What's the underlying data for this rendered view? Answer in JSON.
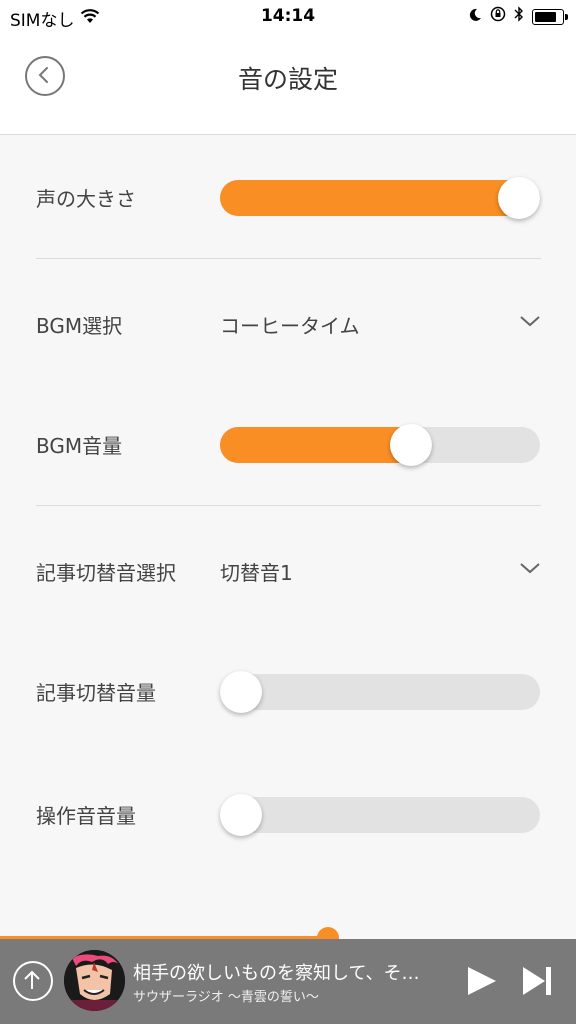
{
  "status_bar": {
    "carrier": "SIMなし",
    "time": "14:14"
  },
  "header": {
    "title": "音の設定"
  },
  "settings": {
    "voice_volume": {
      "label": "声の大きさ",
      "value": 1.0
    },
    "bgm_select": {
      "label": "BGM選択",
      "value": "コーヒータイム"
    },
    "bgm_volume": {
      "label": "BGM音量",
      "value": 0.61
    },
    "article_sound_select": {
      "label": "記事切替音選択",
      "value": "切替音1"
    },
    "article_sound_volume": {
      "label": "記事切替音量",
      "value": 0.0
    },
    "operation_sound_volume": {
      "label": "操作音音量",
      "value": 0.0
    }
  },
  "player": {
    "title": "相手の欲しいものを察知して、そ…",
    "subtitle": "サウザーラジオ 〜青雲の誓い〜",
    "progress": 0.57
  },
  "colors": {
    "accent": "#f98e25",
    "track": "#e2e2e2",
    "player_bg": "#7a7a7a"
  }
}
